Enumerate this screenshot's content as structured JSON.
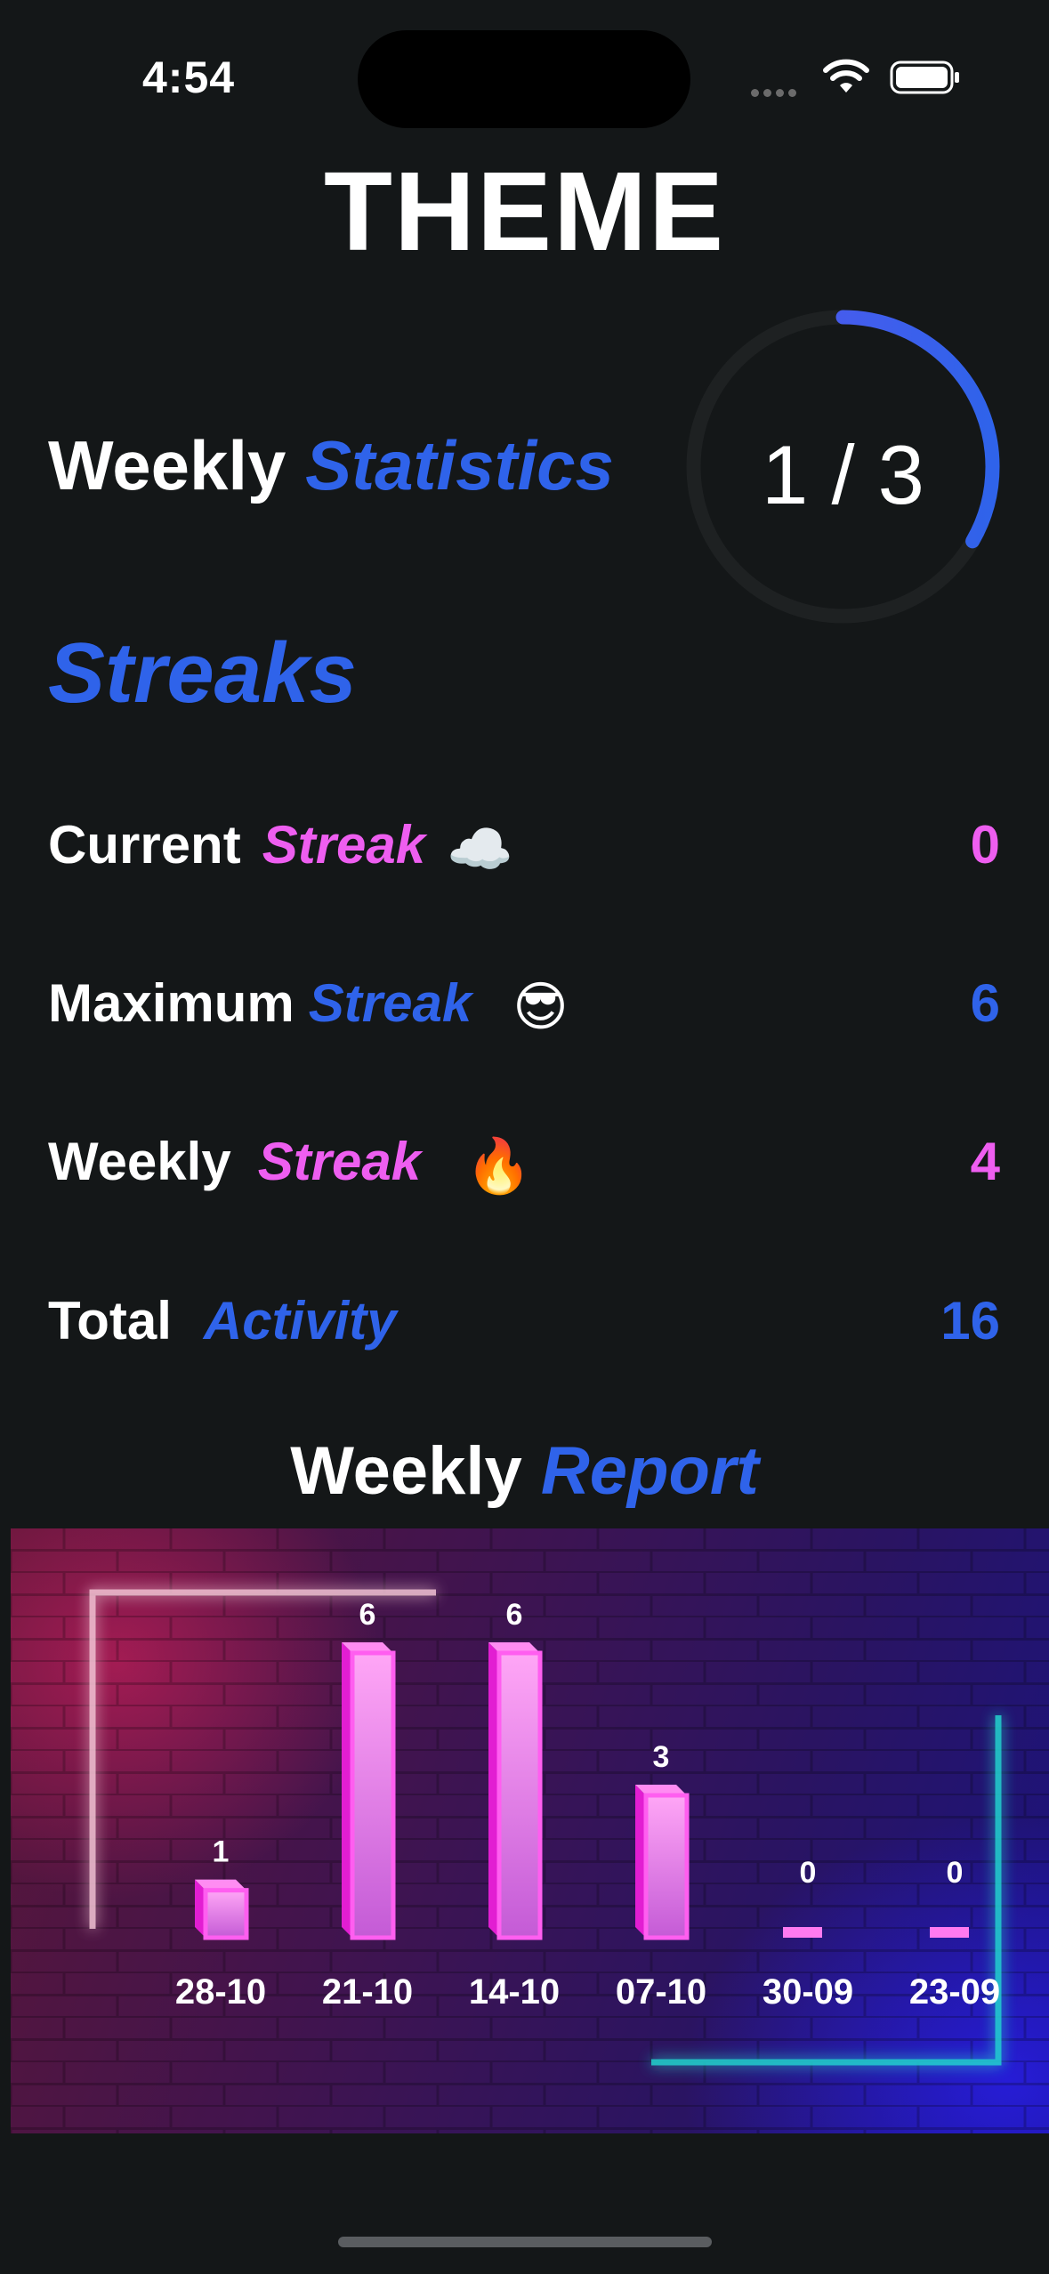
{
  "status_bar": {
    "time": "4:54"
  },
  "header": {
    "title": "THEME"
  },
  "weekly_statistics": {
    "label_plain": "Weekly",
    "label_accent": "Statistics",
    "progress_text": "1 / 3",
    "progress_fraction": 0.333
  },
  "streaks": {
    "heading": "Streaks",
    "rows": [
      {
        "plain": "Current",
        "accent": "Streak",
        "emoji": "☁️",
        "value": "0"
      },
      {
        "plain": "Maximum",
        "accent": "Streak",
        "emoji": "😎",
        "value": "6"
      },
      {
        "plain": "Weekly",
        "accent": "Streak",
        "emoji": "🔥",
        "value": "4"
      },
      {
        "plain": "Total",
        "accent": "Activity",
        "emoji": "",
        "value": "16"
      }
    ]
  },
  "weekly_report": {
    "label_plain": "Weekly",
    "label_accent": "Report"
  },
  "colors": {
    "blue": "#2f63ea",
    "pink": "#ee5ef0",
    "bar": "#ff3ee8",
    "background": "#141718"
  },
  "chart_data": {
    "type": "bar",
    "categories": [
      "28-10",
      "21-10",
      "14-10",
      "07-10",
      "30-09",
      "23-09"
    ],
    "values": [
      1,
      6,
      6,
      3,
      0,
      0
    ],
    "ylim": [
      0,
      6
    ]
  }
}
